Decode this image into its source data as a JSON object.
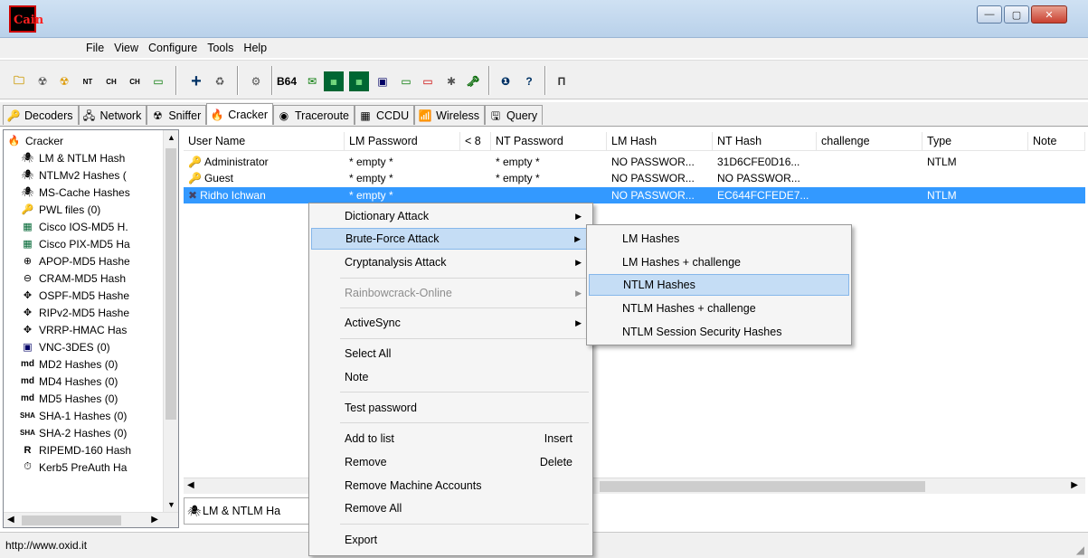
{
  "window": {
    "min": "—",
    "max": "▢",
    "close": "✕"
  },
  "menu": [
    "File",
    "View",
    "Configure",
    "Tools",
    "Help"
  ],
  "tabs": [
    {
      "label": "Decoders",
      "icon": "decoders-icon",
      "glyph": "🔑"
    },
    {
      "label": "Network",
      "icon": "network-icon",
      "glyph": "🖧"
    },
    {
      "label": "Sniffer",
      "icon": "sniffer-icon",
      "glyph": "☢"
    },
    {
      "label": "Cracker",
      "icon": "cracker-icon",
      "glyph": "🔥"
    },
    {
      "label": "Traceroute",
      "icon": "traceroute-icon",
      "glyph": "◉"
    },
    {
      "label": "CCDU",
      "icon": "ccdu-icon",
      "glyph": "▦"
    },
    {
      "label": "Wireless",
      "icon": "wireless-icon",
      "glyph": "📶"
    },
    {
      "label": "Query",
      "icon": "query-icon",
      "glyph": "🖫"
    }
  ],
  "toolbar_labels": {
    "b64": "B64"
  },
  "tree": [
    {
      "label": "Cracker",
      "glyph": "🔥"
    },
    {
      "label": "LM & NTLM Hash",
      "glyph": "🕷"
    },
    {
      "label": "NTLMv2 Hashes (",
      "glyph": "🕷"
    },
    {
      "label": "MS-Cache Hashes",
      "glyph": "🕷"
    },
    {
      "label": "PWL files (0)",
      "glyph": "🔑"
    },
    {
      "label": "Cisco IOS-MD5 H.",
      "glyph": "▦"
    },
    {
      "label": "Cisco PIX-MD5 Ha",
      "glyph": "▦"
    },
    {
      "label": "APOP-MD5 Hashe",
      "glyph": "⊕"
    },
    {
      "label": "CRAM-MD5 Hash",
      "glyph": "⊖"
    },
    {
      "label": "OSPF-MD5 Hashe",
      "glyph": "✥"
    },
    {
      "label": "RIPv2-MD5 Hashe",
      "glyph": "✥"
    },
    {
      "label": "VRRP-HMAC Has",
      "glyph": "✥"
    },
    {
      "label": "VNC-3DES (0)",
      "glyph": "▣"
    },
    {
      "label": "MD2 Hashes (0)",
      "glyph": "md"
    },
    {
      "label": "MD4 Hashes (0)",
      "glyph": "md"
    },
    {
      "label": "MD5 Hashes (0)",
      "glyph": "md"
    },
    {
      "label": "SHA-1 Hashes (0)",
      "glyph": "SHA"
    },
    {
      "label": "SHA-2 Hashes (0)",
      "glyph": "SHA"
    },
    {
      "label": "RIPEMD-160 Hash",
      "glyph": "R"
    },
    {
      "label": "Kerb5 PreAuth Ha",
      "glyph": "⏱"
    }
  ],
  "columns": [
    "User Name",
    "LM Password",
    "< 8",
    "NT Password",
    "LM Hash",
    "NT Hash",
    "challenge",
    "Type",
    "Note"
  ],
  "rows": [
    {
      "icon": "🔑",
      "user": "Administrator",
      "lm_pw": "* empty *",
      "lt8": "",
      "nt_pw": "* empty *",
      "lm_hash": "NO PASSWOR...",
      "nt_hash": "31D6CFE0D16...",
      "challenge": "",
      "type": "NTLM",
      "note": ""
    },
    {
      "icon": "🔑",
      "user": "Guest",
      "lm_pw": "* empty *",
      "lt8": "",
      "nt_pw": "* empty *",
      "lm_hash": "NO PASSWOR...",
      "nt_hash": "NO PASSWOR...",
      "challenge": "",
      "type": "",
      "note": ""
    },
    {
      "icon": "✖",
      "user": "Ridho Ichwan",
      "lm_pw": "* empty *",
      "lt8": "",
      "nt_pw": "",
      "lm_hash": "NO PASSWOR...",
      "nt_hash": "EC644FCFEDE7...",
      "challenge": "",
      "type": "NTLM",
      "note": ""
    }
  ],
  "bottom_tab": {
    "label": "LM & NTLM Ha"
  },
  "context_menu": {
    "dictionary": "Dictionary Attack",
    "brute": "Brute-Force Attack",
    "crypt": "Cryptanalysis Attack",
    "rainbow": "Rainbowcrack-Online",
    "activesync": "ActiveSync",
    "select_all": "Select All",
    "note": "Note",
    "test": "Test password",
    "add": "Add to list",
    "add_sc": "Insert",
    "remove": "Remove",
    "remove_sc": "Delete",
    "remove_machine": "Remove Machine Accounts",
    "remove_all": "Remove All",
    "export": "Export"
  },
  "submenu": [
    "LM Hashes",
    "LM Hashes + challenge",
    "NTLM Hashes",
    "NTLM Hashes + challenge",
    "NTLM Session Security Hashes"
  ],
  "status": "http://www.oxid.it"
}
